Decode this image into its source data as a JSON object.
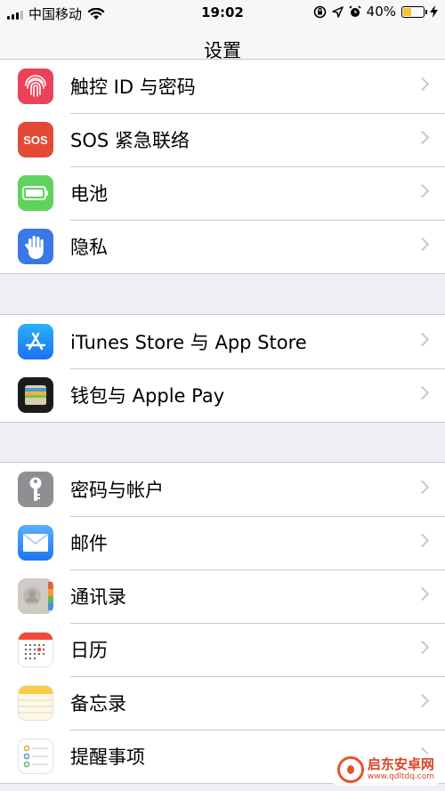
{
  "status_bar": {
    "carrier": "中国移动",
    "time": "19:02",
    "battery_percent": "40%",
    "battery_level": 0.4,
    "icons": [
      "signal-bars-icon",
      "wifi-icon",
      "orientation-lock-icon",
      "location-arrow-icon",
      "alarm-icon",
      "battery-icon",
      "charging-bolt-icon"
    ]
  },
  "nav": {
    "title": "设置"
  },
  "groups": [
    {
      "items": [
        {
          "label": "触控 ID 与密码",
          "icon": "fingerprint-icon",
          "color": "#e8435a"
        },
        {
          "label": "SOS 紧急联络",
          "icon": "sos-icon",
          "icon_text": "SOS",
          "color": "#e34935"
        },
        {
          "label": "电池",
          "icon": "battery-icon",
          "color": "#5fd35b"
        },
        {
          "label": "隐私",
          "icon": "hand-icon",
          "color": "#3b78e7"
        }
      ]
    },
    {
      "items": [
        {
          "label": "iTunes Store 与 App Store",
          "icon": "app-store-icon",
          "color": "#1e8ef5"
        },
        {
          "label": "钱包与 Apple Pay",
          "icon": "wallet-icon",
          "color": "#1c1c1e"
        }
      ]
    },
    {
      "items": [
        {
          "label": "密码与帐户",
          "icon": "key-icon",
          "color": "#8e8e93"
        },
        {
          "label": "邮件",
          "icon": "mail-icon",
          "color": "#2a86f4"
        },
        {
          "label": "通讯录",
          "icon": "contacts-icon",
          "color": "#c9c5c0"
        },
        {
          "label": "日历",
          "icon": "calendar-icon",
          "color": "#ffffff"
        },
        {
          "label": "备忘录",
          "icon": "notes-icon",
          "color": "#fdf8e8"
        },
        {
          "label": "提醒事项",
          "icon": "reminders-icon",
          "color": "#ffffff"
        }
      ]
    }
  ],
  "watermark": {
    "name": "启东安卓网",
    "url": "www.qdltdq.com"
  }
}
